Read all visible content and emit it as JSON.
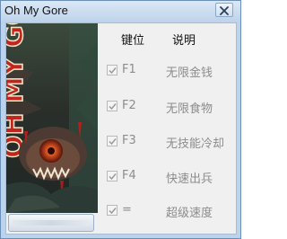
{
  "window": {
    "title": "Oh My Gore"
  },
  "art": {
    "title_text": "OH MY GORE!"
  },
  "table": {
    "header_key": "键位",
    "header_desc": "说明",
    "rows": [
      {
        "key": "F1",
        "desc": "无限金钱",
        "checked": true
      },
      {
        "key": "F2",
        "desc": "无限食物",
        "checked": true
      },
      {
        "key": "F3",
        "desc": "无技能冷却",
        "checked": true
      },
      {
        "key": "F4",
        "desc": "快速出兵",
        "checked": true
      },
      {
        "key": "=",
        "desc": "超级速度",
        "checked": true
      }
    ]
  },
  "colors": {
    "title_bar": "#bdd2ea",
    "client_bg": "#f0f0f0",
    "disabled_text": "#8c8c8c",
    "gore_red": "#c0261d"
  }
}
